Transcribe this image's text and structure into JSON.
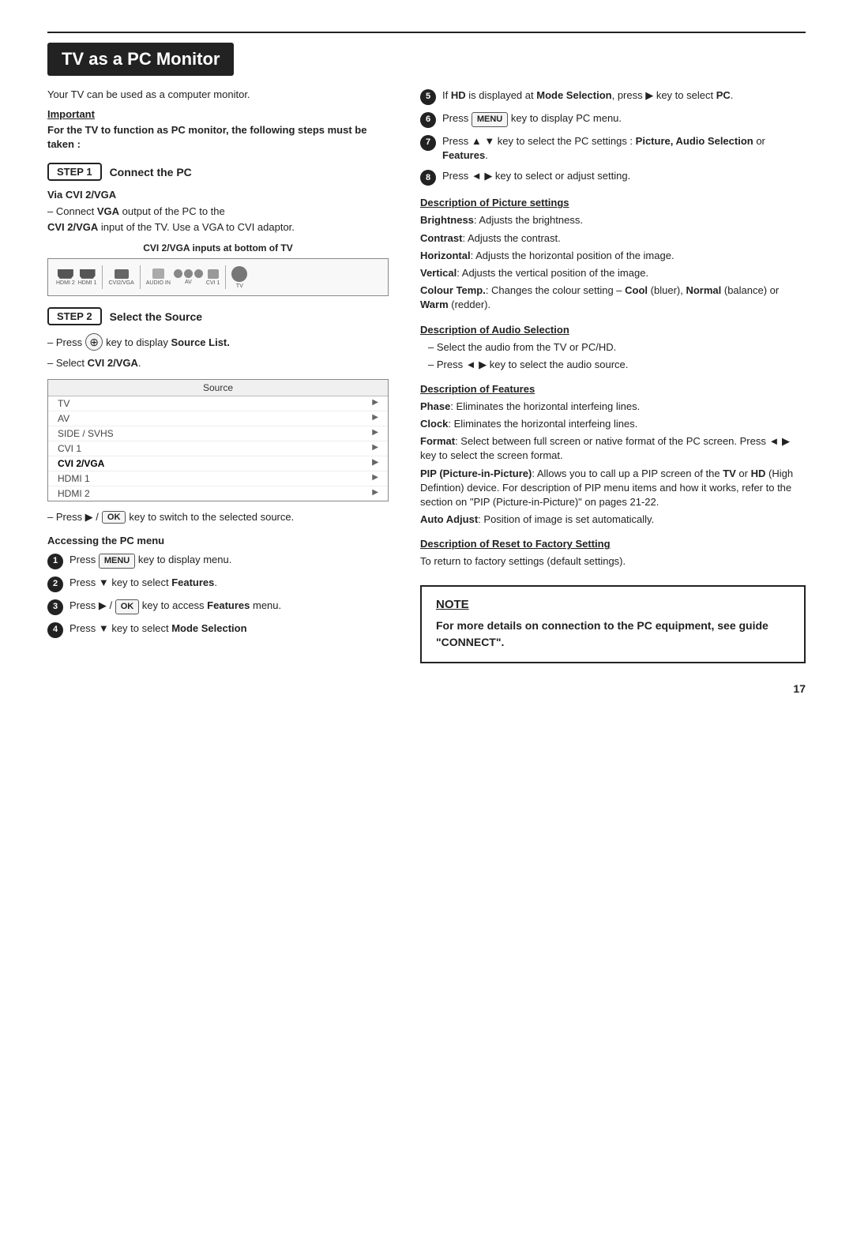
{
  "page": {
    "title": "TV as a PC Monitor",
    "page_number": "17"
  },
  "intro": {
    "text": "Your TV can be used as a computer monitor.",
    "important_label": "Important",
    "important_body": "For the TV to function as PC monitor, the following steps must be taken :"
  },
  "step1": {
    "badge": "STEP 1",
    "title": "Connect the PC",
    "via_label": "Via CVI 2/VGA",
    "line1": "– Connect ",
    "line1_bold": "VGA",
    "line1_cont": " output of the PC to the",
    "line2_bold": "CVI 2/VGA",
    "line2_cont": " input of the TV. Use a VGA to CVI adaptor.",
    "cvi_label": "CVI 2/VGA inputs at bottom of TV"
  },
  "step2": {
    "badge": "STEP 2",
    "title": "Select the Source",
    "press_line": "– Press",
    "press_key_icon": "⊕",
    "press_cont": "key to display",
    "press_bold": "Source List.",
    "select_line": "– Select",
    "select_bold": "CVI 2/VGA",
    "select_cont": ".",
    "source_header": "Source",
    "source_items": [
      {
        "label": "TV",
        "arrow": "▶",
        "selected": false
      },
      {
        "label": "AV",
        "arrow": "▶",
        "selected": false
      },
      {
        "label": "SIDE / SVHS",
        "arrow": "▶",
        "selected": false
      },
      {
        "label": "CVI 1",
        "arrow": "▶",
        "selected": false
      },
      {
        "label": "CVI 2/VGA",
        "arrow": "▶",
        "selected": true
      },
      {
        "label": "HDMI 1",
        "arrow": "▶",
        "selected": false
      },
      {
        "label": "HDMI 2",
        "arrow": "▶",
        "selected": false
      }
    ],
    "press2_line": "– Press ▶ /",
    "press2_badge": "OK",
    "press2_cont": "key to switch to the selected source."
  },
  "accessing": {
    "label": "Accessing the PC menu",
    "items": [
      {
        "num": "❶",
        "text_pre": "Press",
        "badge": "MENU",
        "text_post": "key to display menu."
      },
      {
        "num": "❷",
        "text_pre": "Press ▼ key to select",
        "bold": "Features",
        "text_post": "."
      },
      {
        "num": "❸",
        "text_pre": "Press ▶ /",
        "badge": "OK",
        "text_post": "key to access",
        "bold2": "Features",
        "text_post2": "menu."
      },
      {
        "num": "❹",
        "text_pre": "Press ▼ key to select",
        "bold": "Mode Selection"
      }
    ]
  },
  "right": {
    "item5": {
      "text_pre": "If",
      "bold_pre": "HD",
      "text_mid": "is displayed at",
      "bold_mid": "Mode Selection",
      "text_post": ",",
      "line2": "press ▶ key to select",
      "line2_bold": "PC",
      "line2_post": "."
    },
    "item6": {
      "text_pre": "Press",
      "badge": "MENU",
      "text_post": "key to display PC menu."
    },
    "item7": {
      "text": "Press ▲ ▼ key to select the PC settings :",
      "bold": "Picture, Audio Selection",
      "bold2": "or",
      "bold3": "Features",
      "text_post": "."
    },
    "item8": {
      "text": "Press ◄ ▶ key to select or adjust setting."
    },
    "desc_picture": {
      "heading": "Description of Picture settings",
      "items": [
        {
          "bold": "Brightness",
          "text": ": Adjusts the brightness."
        },
        {
          "bold": "Contrast",
          "text": ": Adjusts the contrast."
        },
        {
          "bold": "Horizontal",
          "text": ": Adjusts the horizontal position of the image."
        },
        {
          "bold": "Vertical",
          "text": ": Adjusts the vertical position of the image."
        },
        {
          "bold": "Colour Temp.",
          "text": ": Changes the colour setting – "
        },
        {
          "bold2": "Cool",
          "text2": " (bluer), ",
          "bold3": "Normal",
          "text3": " (balance) or ",
          "bold4": "Warm",
          "text4": " (redder)."
        }
      ]
    },
    "desc_audio": {
      "heading": "Description of Audio Selection",
      "items": [
        "– Select the audio from the TV or PC/HD.",
        "– Press ◄ ▶ key to select the audio source."
      ]
    },
    "desc_features": {
      "heading": "Description of Features",
      "items": [
        {
          "bold": "Phase",
          "text": ": Eliminates the horizontal interfeing lines."
        },
        {
          "bold": "Clock",
          "text": ": Eliminates the horizontal interfeing lines."
        },
        {
          "bold": "Format",
          "text": ": Select between full screen or native format of the PC screen. Press ◄ ▶ key to select the screen format."
        },
        {
          "bold": "PIP (Picture-in-Picture)",
          "text": ": Allows you to call up a PIP screen of the ",
          "bold2": "TV",
          "text2": " or ",
          "bold3": "HD",
          "text3": " (High Defintion) device. For description of PIP menu items and how it works, refer to the section on \"PIP (Picture-in-Picture)\" on pages 21-22."
        },
        {
          "bold": "Auto Adjust",
          "text": ": Position of image is set automatically."
        }
      ]
    },
    "desc_reset": {
      "heading": "Description of Reset to Factory Setting",
      "text": "To return to factory settings (default settings)."
    }
  },
  "note": {
    "title": "NOTE",
    "body": "For more details on connection to the PC equipment, see guide \"CONNECT\"."
  }
}
